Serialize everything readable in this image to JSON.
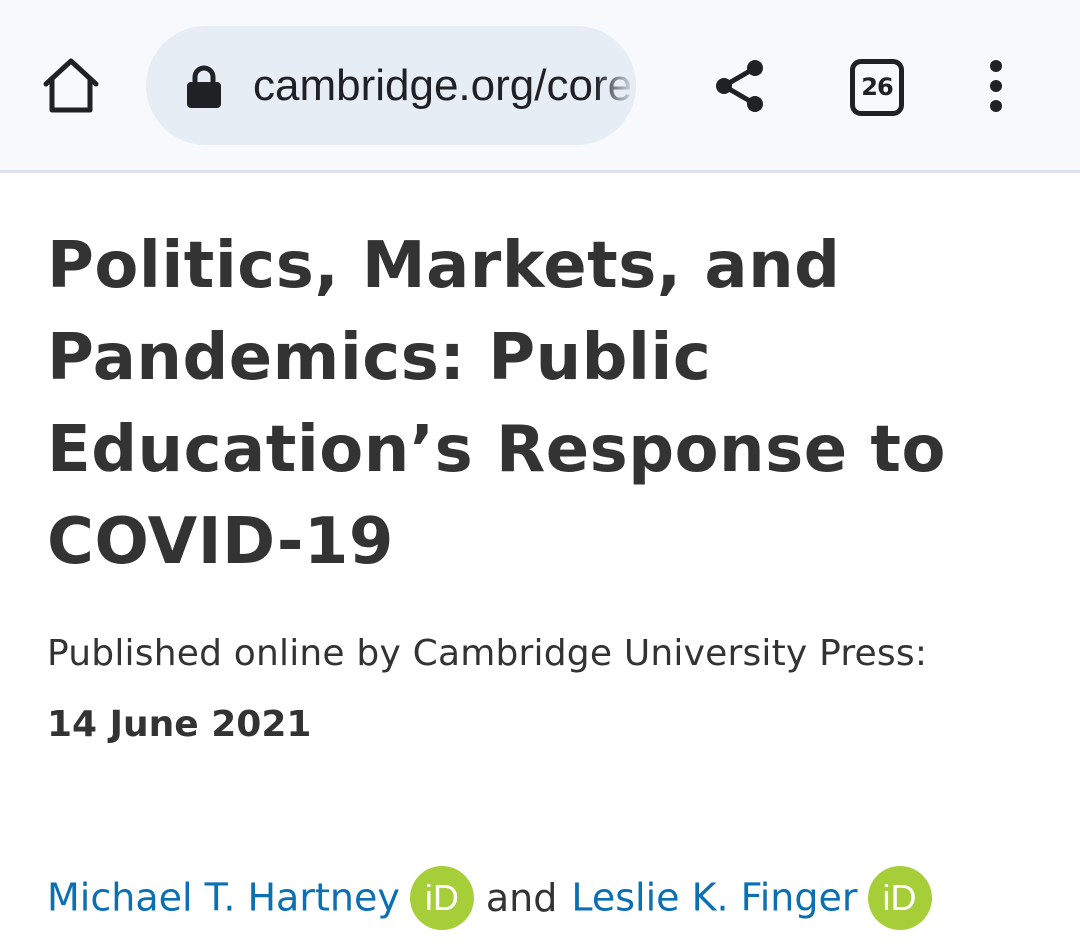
{
  "toolbar": {
    "url": "cambridge.org/core/journals/perspectives-on-politics",
    "tab_count": "26",
    "icons": [
      "home-icon",
      "lock-icon",
      "share-icon",
      "tab-switcher-icon",
      "overflow-menu-icon"
    ],
    "colors": {
      "toolbar_bg": "#f8f9fc",
      "omnibox_bg": "#e6edf5"
    }
  },
  "article": {
    "title": "Politics, Markets, and Pandemics: Public Education’s Response to COVID-19",
    "published_label": "Published online by Cambridge University Press:",
    "published_date": "14 June 2021",
    "authors": [
      {
        "name": "Michael T. Hartney",
        "badge": "iD"
      },
      {
        "name": "Leslie K. Finger",
        "badge": "iD"
      }
    ],
    "authors_conjunction": "and",
    "colors": {
      "title": "#333333",
      "link": "#0a6fb3",
      "orcid": "#a6ce39"
    }
  }
}
